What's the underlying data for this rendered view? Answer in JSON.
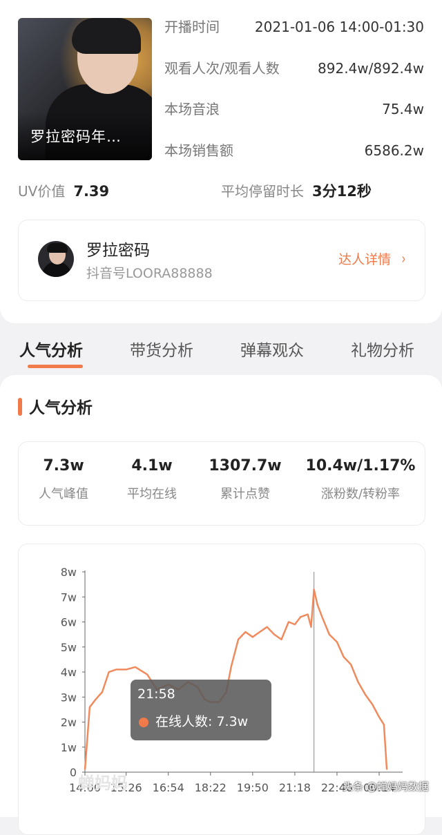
{
  "live": {
    "cover_title": "罗拉密码年…",
    "info": [
      {
        "label": "开播时间",
        "value": "2021-01-06 14:00-01:30"
      },
      {
        "label": "观看人次/观看人数",
        "value": "892.4w/892.4w"
      },
      {
        "label": "本场音浪",
        "value": "75.4w"
      },
      {
        "label": "本场销售额",
        "value": "6586.2w"
      }
    ],
    "uv_label": "UV价值",
    "uv_value": "7.39",
    "stay_label": "平均停留时长",
    "stay_value": "3分12秒"
  },
  "author": {
    "name": "罗拉密码",
    "douyin_id": "抖音号LOORA88888",
    "detail_link": "达人详情",
    "chevron": "›"
  },
  "tabs": [
    {
      "label": "人气分析",
      "active": true
    },
    {
      "label": "带货分析",
      "active": false
    },
    {
      "label": "弹幕观众",
      "active": false
    },
    {
      "label": "礼物分析",
      "active": false
    }
  ],
  "section": {
    "title": "人气分析"
  },
  "stats": [
    {
      "value": "7.3w",
      "label": "人气峰值"
    },
    {
      "value": "4.1w",
      "label": "平均在线"
    },
    {
      "value": "1307.7w",
      "label": "累计点赞"
    },
    {
      "value": "10.4w/1.17%",
      "label": "涨粉数/转粉率"
    }
  ],
  "tooltip": {
    "time": "21:58",
    "label": "在线人数: 7.3w"
  },
  "watermark": "蝉妈妈",
  "credit": "头条 @蝉妈妈数据",
  "colors": {
    "accent": "#f07a4a",
    "line": "#f08a5d"
  },
  "chart_data": {
    "type": "line",
    "ylim": [
      0,
      8
    ],
    "y_ticks": [
      "0",
      "1w",
      "2w",
      "3w",
      "4w",
      "5w",
      "6w",
      "7w",
      "8w"
    ],
    "x_ticks": [
      "14:00",
      "15:26",
      "16:54",
      "18:22",
      "19:50",
      "21:18",
      "22:46",
      "00:14"
    ],
    "cursor_x": "21:58",
    "series": [
      {
        "unit": "w",
        "x": [
          "14:00",
          "14:10",
          "14:22",
          "14:36",
          "14:50",
          "15:05",
          "15:26",
          "15:45",
          "16:10",
          "16:30",
          "16:54",
          "17:15",
          "17:35",
          "17:55",
          "18:10",
          "18:22",
          "18:40",
          "18:55",
          "19:05",
          "19:20",
          "19:35",
          "19:50",
          "20:05",
          "20:20",
          "20:35",
          "20:50",
          "21:05",
          "21:18",
          "21:30",
          "21:45",
          "21:52",
          "21:58",
          "22:05",
          "22:15",
          "22:30",
          "22:46",
          "23:00",
          "23:15",
          "23:30",
          "23:45",
          "00:00",
          "00:14",
          "00:24",
          "00:30"
        ],
        "values": [
          0.1,
          2.6,
          2.9,
          3.2,
          4.0,
          4.1,
          4.1,
          4.2,
          3.9,
          3.3,
          3.5,
          3.3,
          3.6,
          3.4,
          2.9,
          2.8,
          2.8,
          3.2,
          4.2,
          5.3,
          5.6,
          5.4,
          5.6,
          5.8,
          5.5,
          5.3,
          6.0,
          5.9,
          6.2,
          6.3,
          5.8,
          7.3,
          6.7,
          6.2,
          5.5,
          5.2,
          4.6,
          4.3,
          3.6,
          3.1,
          2.7,
          2.2,
          1.9,
          0.1
        ]
      }
    ]
  }
}
